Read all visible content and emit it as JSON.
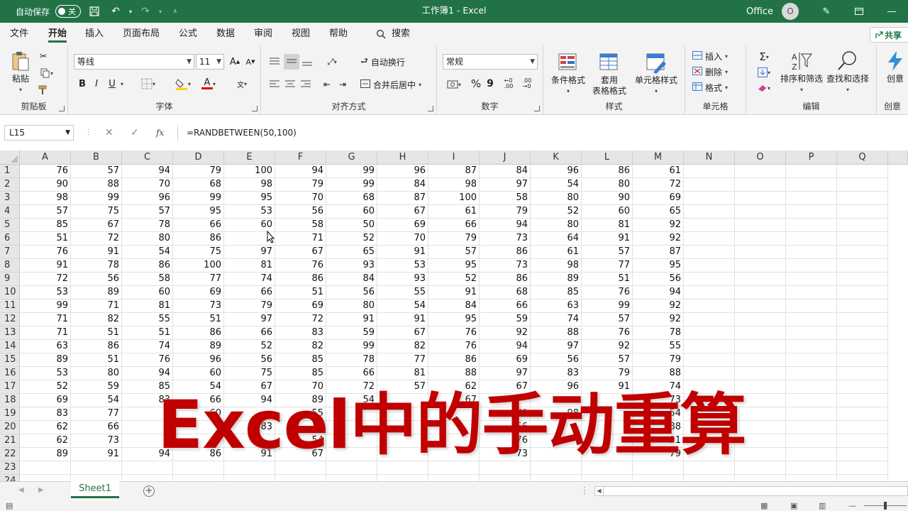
{
  "titlebar": {
    "autosave_label": "自动保存",
    "autosave_state": "关",
    "title": "工作簿1  -  Excel",
    "account": "Office",
    "avatar_initial": "O"
  },
  "menu": {
    "tabs": [
      "文件",
      "开始",
      "插入",
      "页面布局",
      "公式",
      "数据",
      "审阅",
      "视图",
      "帮助"
    ],
    "active_tab": "开始",
    "search_label": "搜索",
    "share_label": "共享"
  },
  "ribbon": {
    "clipboard": {
      "paste_label": "粘贴",
      "group_label": "剪贴板"
    },
    "font": {
      "font_name": "等线",
      "font_size": "11",
      "bold": "B",
      "italic": "I",
      "underline": "U",
      "group_label": "字体"
    },
    "alignment": {
      "wrap_text": "自动换行",
      "merge_center": "合并后居中",
      "group_label": "对齐方式"
    },
    "number": {
      "format": "常规",
      "percent": "%",
      "comma": "9",
      "group_label": "数字"
    },
    "styles": {
      "conditional": "条件格式",
      "table_format_l1": "套用",
      "table_format_l2": "表格格式",
      "cell_styles": "单元格样式",
      "group_label": "样式"
    },
    "cells": {
      "insert": "插入",
      "delete": "删除",
      "format": "格式",
      "group_label": "单元格"
    },
    "editing": {
      "sort_filter": "排序和筛选",
      "find_select": "查找和选择",
      "group_label": "编辑"
    },
    "creative": {
      "label": "创意",
      "group_label": "创意"
    }
  },
  "formula_bar": {
    "name_box": "L15",
    "fx": "fx",
    "formula": "=RANDBETWEEN(50,100)"
  },
  "sheet": {
    "columns": [
      "A",
      "B",
      "C",
      "D",
      "E",
      "F",
      "G",
      "H",
      "I",
      "J",
      "K",
      "L",
      "M",
      "N",
      "O",
      "P",
      "Q"
    ],
    "row_numbers": [
      "1",
      "2",
      "3",
      "4",
      "5",
      "6",
      "7",
      "8",
      "9",
      "10",
      "11",
      "12",
      "13",
      "14",
      "15",
      "16",
      "17",
      "18",
      "19",
      "20",
      "21",
      "22",
      "23",
      "24"
    ],
    "rows": [
      [
        "76",
        "57",
        "94",
        "79",
        "100",
        "94",
        "99",
        "96",
        "87",
        "84",
        "96",
        "86",
        "61"
      ],
      [
        "90",
        "88",
        "70",
        "68",
        "98",
        "79",
        "99",
        "84",
        "98",
        "97",
        "54",
        "80",
        "72"
      ],
      [
        "98",
        "99",
        "96",
        "99",
        "95",
        "70",
        "68",
        "87",
        "100",
        "58",
        "80",
        "90",
        "69"
      ],
      [
        "57",
        "75",
        "57",
        "95",
        "53",
        "56",
        "60",
        "67",
        "61",
        "79",
        "52",
        "60",
        "65"
      ],
      [
        "85",
        "67",
        "78",
        "66",
        "60",
        "58",
        "50",
        "69",
        "66",
        "94",
        "80",
        "81",
        "92"
      ],
      [
        "51",
        "72",
        "80",
        "86",
        "",
        "71",
        "52",
        "70",
        "79",
        "73",
        "64",
        "91",
        "92"
      ],
      [
        "76",
        "91",
        "54",
        "75",
        "97",
        "67",
        "65",
        "91",
        "57",
        "86",
        "61",
        "57",
        "87"
      ],
      [
        "91",
        "78",
        "86",
        "100",
        "81",
        "76",
        "93",
        "53",
        "95",
        "73",
        "98",
        "77",
        "95"
      ],
      [
        "72",
        "56",
        "58",
        "77",
        "74",
        "86",
        "84",
        "93",
        "52",
        "86",
        "89",
        "51",
        "56"
      ],
      [
        "53",
        "89",
        "60",
        "69",
        "66",
        "51",
        "56",
        "55",
        "91",
        "68",
        "85",
        "76",
        "94"
      ],
      [
        "99",
        "71",
        "81",
        "73",
        "79",
        "69",
        "80",
        "54",
        "84",
        "66",
        "63",
        "99",
        "92"
      ],
      [
        "71",
        "82",
        "55",
        "51",
        "97",
        "72",
        "91",
        "91",
        "95",
        "59",
        "74",
        "57",
        "92"
      ],
      [
        "71",
        "51",
        "51",
        "86",
        "66",
        "83",
        "59",
        "67",
        "76",
        "92",
        "88",
        "76",
        "78"
      ],
      [
        "63",
        "86",
        "74",
        "89",
        "52",
        "82",
        "99",
        "82",
        "76",
        "94",
        "97",
        "92",
        "55"
      ],
      [
        "89",
        "51",
        "76",
        "96",
        "56",
        "85",
        "78",
        "77",
        "86",
        "69",
        "56",
        "57",
        "79"
      ],
      [
        "53",
        "80",
        "94",
        "60",
        "75",
        "85",
        "66",
        "81",
        "88",
        "97",
        "83",
        "79",
        "88"
      ],
      [
        "52",
        "59",
        "85",
        "54",
        "67",
        "70",
        "72",
        "57",
        "62",
        "67",
        "96",
        "91",
        "74"
      ],
      [
        "69",
        "54",
        "83",
        "66",
        "94",
        "89",
        "54",
        "",
        "67",
        "",
        "",
        "",
        "73"
      ],
      [
        "83",
        "77",
        "",
        "60",
        "",
        "55",
        "",
        "",
        "",
        "79",
        "98",
        "",
        "54"
      ],
      [
        "62",
        "66",
        "",
        "",
        "83",
        "",
        "",
        "",
        "",
        "56",
        "",
        "",
        "88"
      ],
      [
        "62",
        "73",
        "",
        "",
        "",
        "54",
        "",
        "",
        "",
        "76",
        "",
        "",
        "91"
      ],
      [
        "89",
        "91",
        "94",
        "86",
        "91",
        "67",
        "",
        "",
        "",
        "73",
        "",
        "",
        "79"
      ]
    ],
    "sheet_tab": "Sheet1",
    "add_sheet": "+"
  },
  "overlay_title": "Excel中的手动重算",
  "colors": {
    "accent": "#217346",
    "overlay": "#c00000"
  }
}
